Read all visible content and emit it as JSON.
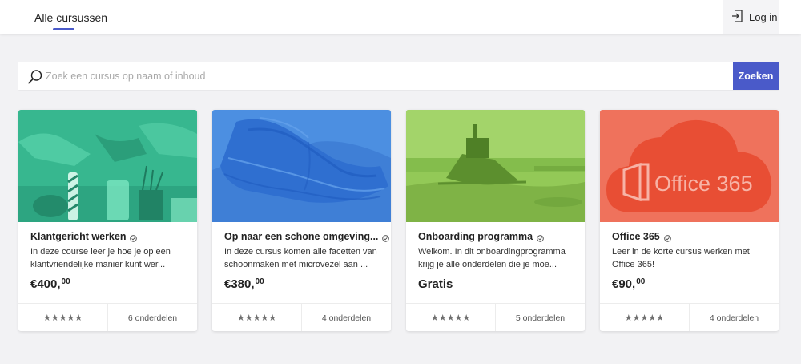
{
  "nav": {
    "tab_label": "Alle cursussen",
    "login_label": "Log in",
    "accent": "#4a5ac9"
  },
  "search": {
    "placeholder": "Zoek een cursus op naam of inhoud",
    "value": "",
    "button_label": "Zoeken"
  },
  "courses": [
    {
      "title": "Klantgericht werken",
      "description": "In deze course leer je hoe je op een klantvriendelijke manier kunt wer...",
      "price_main": "€400,",
      "price_cents": "00",
      "rating": "★★★★★",
      "parts": "6 onderdelen",
      "overlay_color": "#3fc49a",
      "image": "team-meeting-photo"
    },
    {
      "title": "Op naar een schone omgeving...",
      "description": "In deze cursus komen alle facetten van schoonmaken met microvezel aan ...",
      "price_main": "€380,",
      "price_cents": "00",
      "rating": "★★★★★",
      "parts": "4 onderdelen",
      "overlay_color": "#4a8fe0",
      "image": "microfiber-cloth-photo"
    },
    {
      "title": "Onboarding programma",
      "description": "Welkom. In dit onboardingprogramma krijg je alle onderdelen die je moe...",
      "price_main": "Gratis",
      "price_cents": "",
      "rating": "★★★★★",
      "parts": "5 onderdelen",
      "overlay_color": "#8cc84e",
      "image": "shipwreck-photo"
    },
    {
      "title": "Office 365",
      "description": "Leer in de korte cursus werken met Office 365!",
      "price_main": "€90,",
      "price_cents": "00",
      "rating": "★★★★★",
      "parts": "4 onderdelen",
      "overlay_color": "#f06a54",
      "image": "office-365-logo",
      "logo_text": "Office 365"
    }
  ]
}
